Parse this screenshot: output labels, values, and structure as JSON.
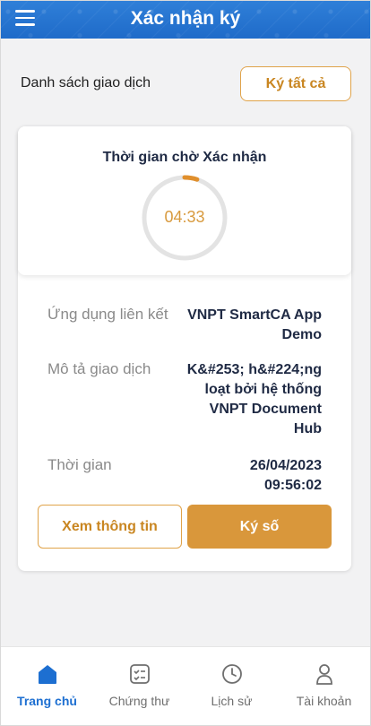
{
  "header": {
    "title": "Xác nhận ký",
    "menu_icon": "menu-icon"
  },
  "list": {
    "title": "Danh sách giao dịch",
    "sign_all_label": "Ký tất cả"
  },
  "timer": {
    "title": "Thời gian chờ Xác nhận",
    "value": "04:33",
    "progress_fraction": 0.05
  },
  "details": [
    {
      "label": "Ứng dụng liên kết",
      "value_lines": [
        "VNPT SmartCA App",
        "Demo"
      ]
    },
    {
      "label": "Mô tả giao dịch",
      "value_lines": [
        "K&#253; h&#224;ng",
        "loạt bởi hệ thống",
        "VNPT Document",
        "Hub"
      ]
    },
    {
      "label": "Thời gian",
      "value_lines": [
        "26/04/2023",
        "09:56:02"
      ]
    }
  ],
  "actions": {
    "view_label": "Xem thông tin",
    "sign_label": "Ký số"
  },
  "nav": [
    {
      "label": "Trang chủ",
      "icon": "home-icon",
      "active": true
    },
    {
      "label": "Chứng thư",
      "icon": "certificate-icon",
      "active": false
    },
    {
      "label": "Lịch sử",
      "icon": "clock-icon",
      "active": false
    },
    {
      "label": "Tài khoản",
      "icon": "user-icon",
      "active": false
    }
  ],
  "colors": {
    "primary": "#1d6fd1",
    "accent": "#d9973b"
  }
}
